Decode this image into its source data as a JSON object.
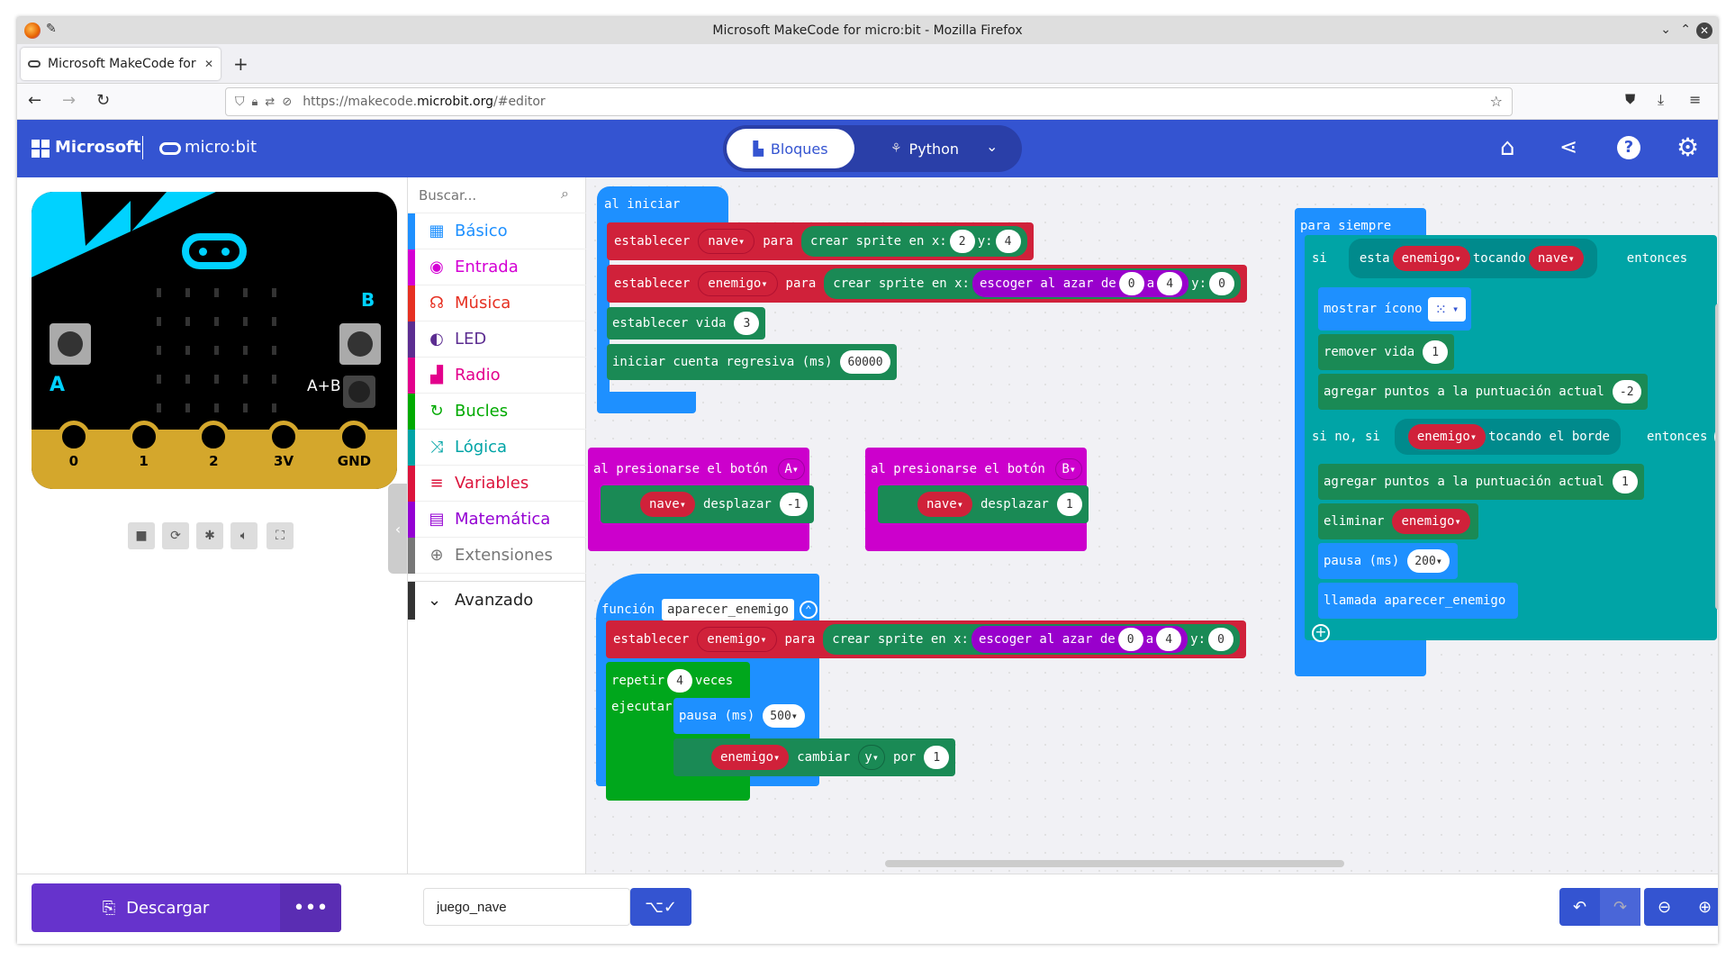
{
  "window": {
    "title": "Microsoft MakeCode for micro:bit - Mozilla Firefox"
  },
  "browser": {
    "tab_title": "Microsoft MakeCode for mi",
    "url_prefix": "https://makecode.",
    "url_domain": "microbit.org",
    "url_suffix": "/#editor"
  },
  "header": {
    "brand": "Microsoft",
    "product": "micro:bit",
    "mode_blocks": "Bloques",
    "mode_python": "Python"
  },
  "simulator": {
    "pins": [
      "0",
      "1",
      "2",
      "3V",
      "GND"
    ],
    "label_a": "A",
    "label_b": "B",
    "label_ab": "A+B"
  },
  "toolbox": {
    "search_placeholder": "Buscar...",
    "categories": [
      {
        "label": "Básico",
        "color": "#1e90ff",
        "icon": "grid-icon"
      },
      {
        "label": "Entrada",
        "color": "#d400d4",
        "icon": "target-icon"
      },
      {
        "label": "Música",
        "color": "#e63022",
        "icon": "headphones-icon"
      },
      {
        "label": "LED",
        "color": "#5c2d91",
        "icon": "toggle-icon"
      },
      {
        "label": "Radio",
        "color": "#e3008c",
        "icon": "signal-icon"
      },
      {
        "label": "Bucles",
        "color": "#00aa00",
        "icon": "refresh-icon"
      },
      {
        "label": "Lógica",
        "color": "#00a4a6",
        "icon": "shuffle-icon"
      },
      {
        "label": "Variables",
        "color": "#dc143c",
        "icon": "list-icon"
      },
      {
        "label": "Matemática",
        "color": "#9400d3",
        "icon": "calculator-icon"
      },
      {
        "label": "Extensiones",
        "color": "#777777",
        "icon": "plus-circle-icon"
      }
    ],
    "advanced": "Avanzado"
  },
  "blocks": {
    "on_start": "al iniciar",
    "set": "establecer",
    "to": "para",
    "create_sprite": "crear sprite en x:",
    "y": "y:",
    "random": "escoger al azar de",
    "a": "a",
    "var_ship": "nave",
    "var_enemy": "enemigo",
    "set_life": "establecer vida",
    "start_countdown": "iniciar cuenta regresiva (ms)",
    "v2": "2",
    "v4": "4",
    "v0": "0",
    "v3": "3",
    "v60000": "60000",
    "on_button": "al presionarse el botón",
    "btn_a": "A",
    "btn_b": "B",
    "move": "desplazar",
    "vneg1": "-1",
    "v1": "1",
    "function": "función",
    "function_name": "aparecer_enemigo",
    "repeat": "repetir",
    "times": "veces",
    "do": "ejecutar",
    "pause": "pausa (ms)",
    "v500": "500",
    "change": "cambiar",
    "axis_y": "y",
    "by": "por",
    "forever": "para siempre",
    "if": "si",
    "is": "esta",
    "touching": "tocando",
    "then": "entonces",
    "show_icon": "mostrar ícono",
    "remove_life": "remover vida",
    "add_score": "agregar puntos a la puntuación actual",
    "vneg2": "-2",
    "else_if": "si no, si",
    "touching_edge": "tocando el borde",
    "delete": "eliminar",
    "v200": "200",
    "call": "llamada aparecer_enemigo"
  },
  "footer": {
    "download": "Descargar",
    "project_name": "juego_nave"
  }
}
